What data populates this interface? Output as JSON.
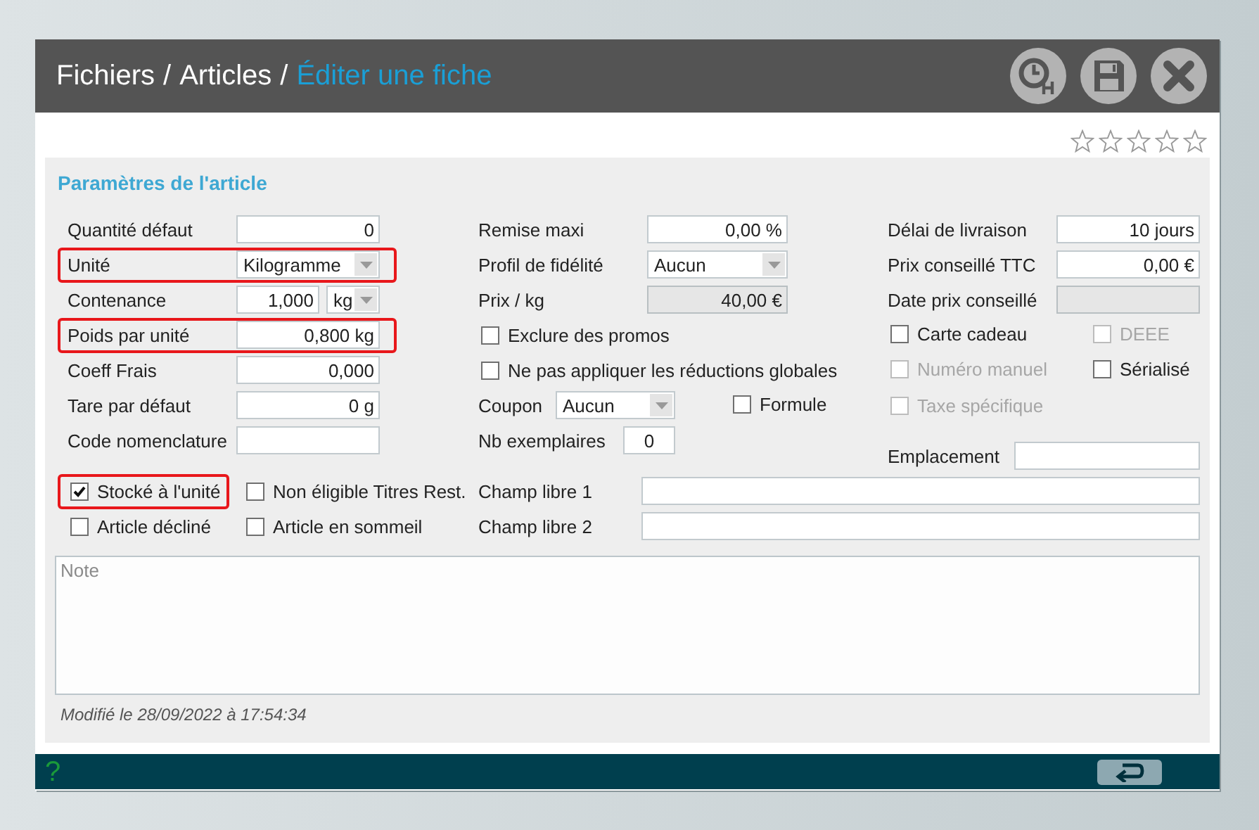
{
  "header": {
    "breadcrumbs": [
      {
        "kind": "crumb",
        "label": "Fichiers",
        "current": false
      },
      {
        "kind": "separator",
        "label": "/"
      },
      {
        "kind": "crumb",
        "label": "Articles",
        "current": false
      },
      {
        "kind": "separator",
        "label": "/"
      },
      {
        "kind": "crumb",
        "label": "Éditer une fiche",
        "current": true
      }
    ]
  },
  "rating": {
    "stars": 0
  },
  "section": {
    "title": "Paramètres de l'article",
    "columns": [
      {
        "fields": [
          {
            "kind": "input",
            "label": "Quantité défaut",
            "value": "0",
            "highlighted": false,
            "disabled": false
          },
          {
            "kind": "select",
            "label": "Unité",
            "value": "Kilogramme",
            "highlighted": true
          },
          {
            "kind": "input_unit",
            "label": "Contenance",
            "value": "1,000",
            "unit": "kg",
            "highlighted": false
          },
          {
            "kind": "input",
            "label": "Poids par unité",
            "value": "0,800 kg",
            "highlighted": true,
            "disabled": false
          },
          {
            "kind": "input",
            "label": "Coeff Frais",
            "value": "0,000",
            "highlighted": false,
            "disabled": false
          },
          {
            "kind": "input",
            "label": "Tare par défaut",
            "value": "0 g",
            "highlighted": false,
            "disabled": false
          },
          {
            "kind": "input",
            "label": "Code nomenclature",
            "highlighted": false,
            "disabled": false
          }
        ],
        "checkboxes": [
          {
            "label": "Stocké à l'unité",
            "checked": true,
            "highlighted": true,
            "disabled": false
          },
          {
            "label": "Non éligible Titres Rest.",
            "checked": false,
            "highlighted": false,
            "disabled": false
          },
          {
            "label": "Article décliné",
            "checked": false,
            "highlighted": false,
            "disabled": false
          },
          {
            "label": "Article en sommeil",
            "checked": false,
            "highlighted": false,
            "disabled": false
          }
        ]
      },
      {
        "fields": [
          {
            "kind": "input",
            "label": "Remise maxi",
            "value": "0,00 %",
            "highlighted": false,
            "disabled": false
          },
          {
            "kind": "select",
            "label": "Profil de fidélité",
            "value": "Aucun",
            "highlighted": false
          },
          {
            "kind": "input",
            "label": "Prix / kg",
            "value": "40,00 €",
            "highlighted": false,
            "disabled": true
          },
          {
            "kind": "checkbox",
            "label": "Exclure des promos",
            "checked": false,
            "highlighted": false,
            "disabled": false
          },
          {
            "kind": "checkbox",
            "label": "Ne pas appliquer les réductions globales",
            "checked": false,
            "highlighted": false,
            "disabled": false
          },
          {
            "kind": "select_check",
            "label": "Coupon",
            "value": "Aucun",
            "highlighted": false,
            "checkbox": {
              "label": "Formule",
              "checked": false,
              "disabled": false
            }
          },
          {
            "kind": "input_inline",
            "label": "Nb exemplaires",
            "value": "0",
            "highlighted": false
          }
        ]
      },
      {
        "fields": [
          {
            "kind": "input",
            "label": "Délai de livraison",
            "value": "10 jours",
            "highlighted": false,
            "disabled": false
          },
          {
            "kind": "input",
            "label": "Prix conseillé TTC",
            "value": "0,00 €",
            "highlighted": false,
            "disabled": false
          },
          {
            "kind": "input",
            "label": "Date prix conseillé",
            "highlighted": false,
            "disabled": true
          },
          {
            "kind": "checkbox_pair",
            "highlighted": false,
            "items": [
              {
                "label": "Carte cadeau",
                "checked": false,
                "disabled": false
              },
              {
                "label": "DEEE",
                "checked": false,
                "disabled": true
              }
            ]
          },
          {
            "kind": "checkbox_pair",
            "highlighted": false,
            "items": [
              {
                "label": "Numéro manuel",
                "checked": false,
                "disabled": true
              },
              {
                "label": "Sérialisé",
                "checked": false,
                "disabled": false
              }
            ]
          },
          {
            "kind": "checkbox",
            "label": "Taxe spécifique",
            "checked": false,
            "highlighted": false,
            "disabled": true
          },
          {
            "kind": "input_wide",
            "label": "Emplacement",
            "highlighted": false
          }
        ]
      }
    ],
    "extra_fields": [
      {
        "label": "Champ libre 1"
      },
      {
        "label": "Champ libre 2"
      }
    ],
    "note": {
      "placeholder": "Note"
    },
    "modified": "Modifié le 28/09/2022 à 17:54:34"
  },
  "footer": {
    "help": "?"
  }
}
